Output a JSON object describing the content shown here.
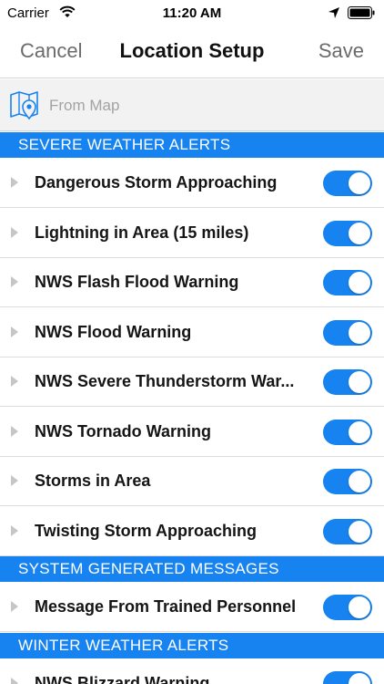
{
  "status": {
    "carrier": "Carrier",
    "time": "11:20 AM"
  },
  "nav": {
    "cancel_label": "Cancel",
    "title": "Location Setup",
    "save_label": "Save"
  },
  "from_map": {
    "label": "From Map",
    "icon": "map-pin-icon"
  },
  "sections": [
    {
      "title": "SEVERE WEATHER ALERTS",
      "items": [
        {
          "label": "Dangerous Storm Approaching",
          "enabled": true
        },
        {
          "label": "Lightning in Area (15 miles)",
          "enabled": true
        },
        {
          "label": "NWS Flash Flood Warning",
          "enabled": true
        },
        {
          "label": "NWS Flood Warning",
          "enabled": true
        },
        {
          "label": "NWS Severe Thunderstorm War...",
          "enabled": true
        },
        {
          "label": "NWS Tornado Warning",
          "enabled": true
        },
        {
          "label": "Storms in Area",
          "enabled": true
        },
        {
          "label": "Twisting Storm Approaching",
          "enabled": true
        }
      ]
    },
    {
      "title": "SYSTEM GENERATED MESSAGES",
      "items": [
        {
          "label": "Message From Trained Personnel",
          "enabled": true
        }
      ]
    },
    {
      "title": "WINTER WEATHER ALERTS",
      "items": [
        {
          "label": "NWS Blizzard Warning",
          "enabled": true
        }
      ]
    }
  ],
  "colors": {
    "accent": "#1783f0",
    "nav_text": "#6b6b6b",
    "placeholder": "#a3a3a3"
  }
}
